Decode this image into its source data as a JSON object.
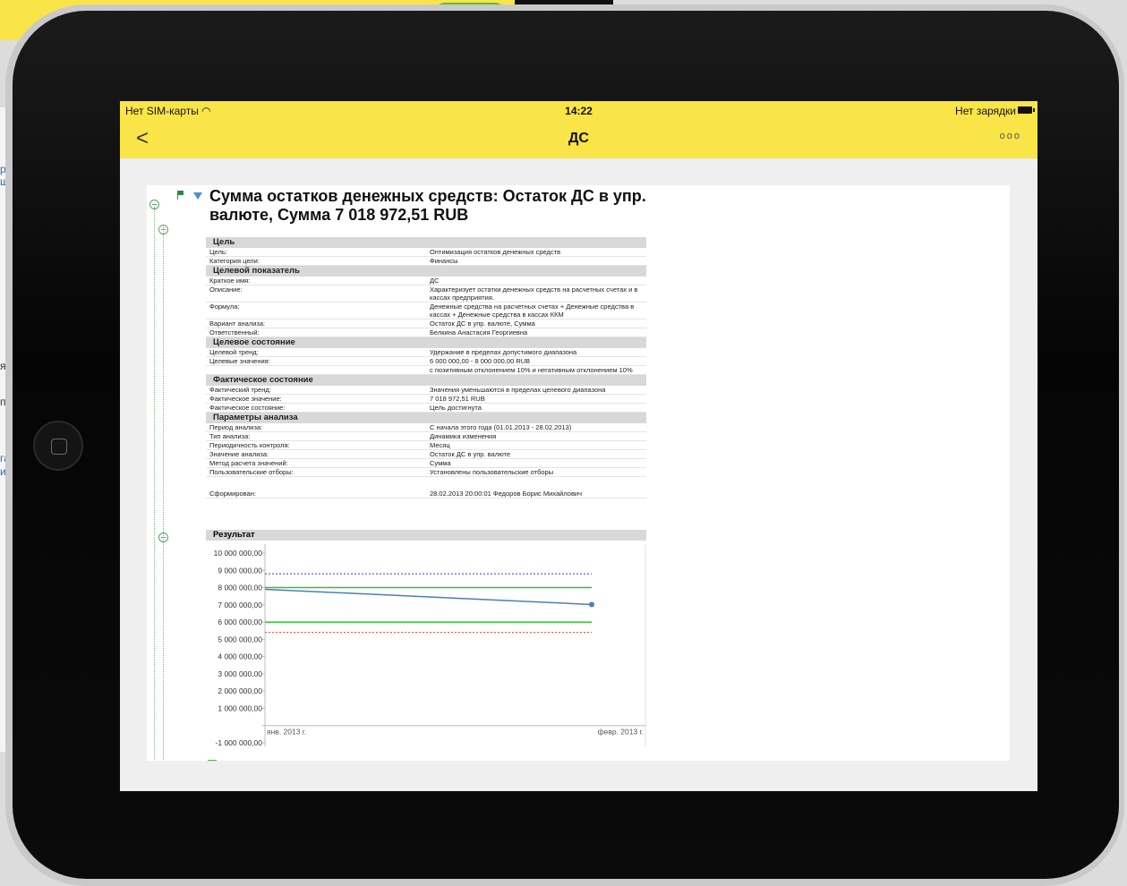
{
  "background": {
    "left_fragments": [
      "р",
      "щ",
      "я",
      "п",
      "га",
      "ия"
    ]
  },
  "statusbar": {
    "carrier": "Нет SIM-карты",
    "time": "14:22",
    "battery": "Нет зарядки"
  },
  "navbar": {
    "back": "<",
    "title": "ДС",
    "more": "ooo"
  },
  "report": {
    "title": "Сумма остатков денежных средств: Остаток ДС в упр. валюте, Сумма 7 018 972,51 RUB",
    "sections": [
      {
        "title": "Цель",
        "rows": [
          {
            "key": "Цель:",
            "value": "Оптимизация остатков денежных средств"
          },
          {
            "key": "Категория цели:",
            "value": "Финансы"
          }
        ]
      },
      {
        "title": "Целевой показатель",
        "rows": [
          {
            "key": "Краткое имя:",
            "value": "ДС"
          },
          {
            "key": "Описание:",
            "value": "Характеризует остатки денежных средств на расчетных счетах и в кассах предприятия."
          },
          {
            "key": "Формула:",
            "value": "Денежные средства на расчетных счетах + Денежные средства в кассах + Денежные средства в кассах ККМ"
          },
          {
            "key": "Вариант анализа:",
            "value": "Остаток ДС в упр. валюте, Сумма"
          },
          {
            "key": "Ответственный:",
            "value": "Белкина Анастасия Георгиевна"
          }
        ]
      },
      {
        "title": "Целевое состояние",
        "rows": [
          {
            "key": "Целевой тренд:",
            "value": "Удержание в пределах допустимого диапазона"
          },
          {
            "key": "Целевые значения:",
            "value": "6 000 000,00 - 8 000 000,00 RUB"
          },
          {
            "key": "",
            "value": "с позитивным отклонением 10% и негативным отклонением 10%"
          }
        ]
      },
      {
        "title": "Фактическое состояние",
        "rows": [
          {
            "key": "Фактический тренд:",
            "value": "Значения уменьшаются в пределах целевого диапазона"
          },
          {
            "key": "Фактическое значение:",
            "value": "7 018 972,51 RUB"
          },
          {
            "key": "Фактическое состояние:",
            "value": "Цель достигнута"
          }
        ]
      },
      {
        "title": "Параметры анализа",
        "rows": [
          {
            "key": "Период анализа:",
            "value": "С начала этого года (01.01.2013 - 28.02.2013)"
          },
          {
            "key": "Тип анализа:",
            "value": "Динамика изменения"
          },
          {
            "key": "Периодичность контроля:",
            "value": "Месяц"
          },
          {
            "key": "Значение анализа:",
            "value": "Остаток ДС в упр. валюте"
          },
          {
            "key": "Метод расчета значений:",
            "value": "Сумма"
          },
          {
            "key": "Пользовательские отборы:",
            "value": "Установлены пользовательские отборы"
          }
        ]
      }
    ],
    "generated": {
      "key": "Сформирован:",
      "value": "28.02.2013 20:00:01 Федоров Борис Михайлович"
    },
    "result_title": "Результат"
  },
  "chart_data": {
    "type": "line",
    "x": [
      "янв. 2013 г.",
      "февр. 2013 г."
    ],
    "series": [
      {
        "values": [
          7900000,
          7018972.51
        ],
        "color": "#4a7fb5"
      }
    ],
    "reference_lines": [
      {
        "value": 8800000,
        "style": "dotted",
        "color": "#3a3acc"
      },
      {
        "value": 8000000,
        "style": "solid",
        "color": "#2ec42e"
      },
      {
        "value": 6000000,
        "style": "solid",
        "color": "#2ec42e"
      },
      {
        "value": 5400000,
        "style": "dotted",
        "color": "#e04040"
      }
    ],
    "yticks": [
      "10 000 000,00",
      "9 000 000,00",
      "8 000 000,00",
      "7 000 000,00",
      "6 000 000,00",
      "5 000 000,00",
      "4 000 000,00",
      "3 000 000,00",
      "2 000 000,00",
      "1 000 000,00",
      "",
      "-1 000 000,00"
    ],
    "ylim": [
      -1000000,
      10000000
    ]
  }
}
